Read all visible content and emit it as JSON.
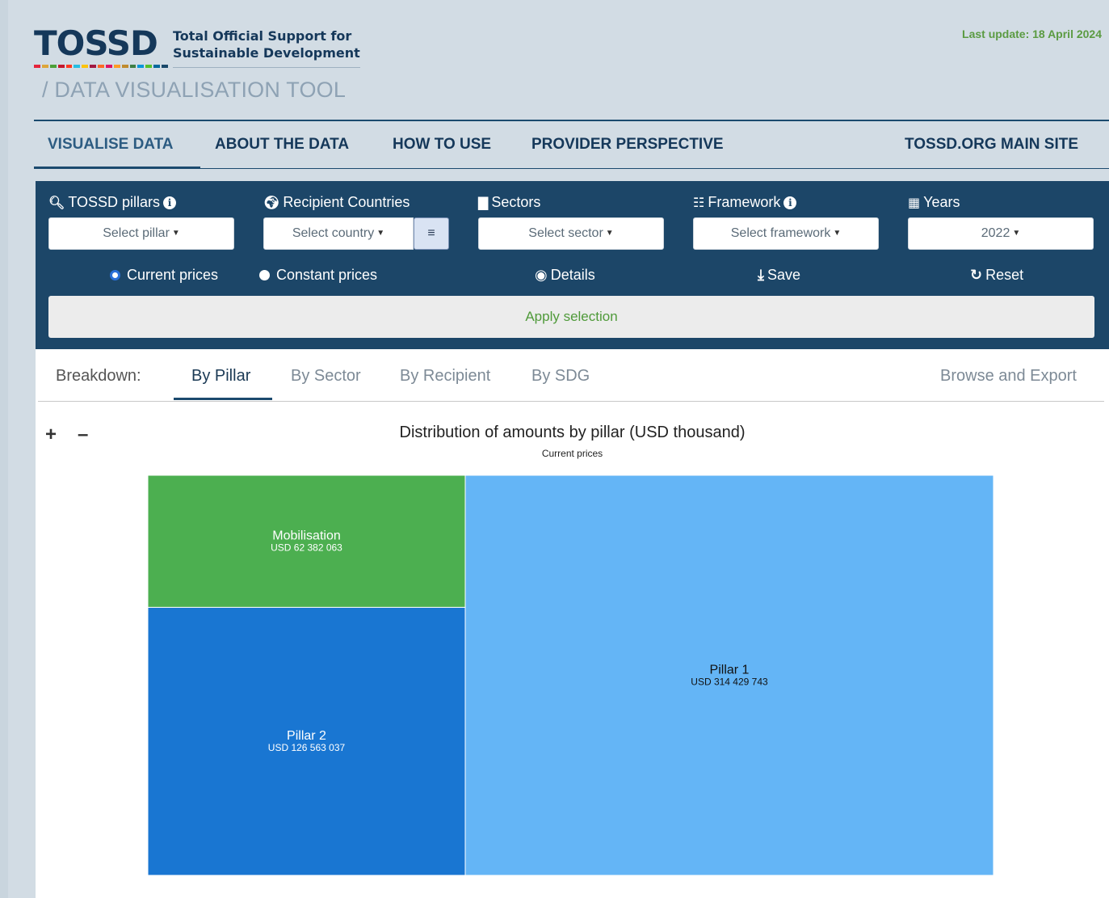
{
  "header": {
    "logo_word": "TOSSD",
    "logo_sub_line1": "Total Official Support for",
    "logo_sub_line2": "Sustainable Development",
    "tool_title": "/ DATA VISUALISATION TOOL",
    "last_update": "Last update: 18 April 2024",
    "sdg_colors": [
      "#e5243b",
      "#dda63a",
      "#4c9f38",
      "#c5192d",
      "#ff3a21",
      "#26bde2",
      "#fcc30b",
      "#a21942",
      "#fd6925",
      "#dd1367",
      "#fd9d24",
      "#bf8b2e",
      "#3f7e44",
      "#0a97d9",
      "#56c02b",
      "#00689d",
      "#19486a"
    ]
  },
  "nav": {
    "visualise": "VISUALISE DATA",
    "about": "ABOUT THE DATA",
    "how_to": "HOW TO USE",
    "provider": "PROVIDER PERSPECTIVE",
    "main_site": "TOSSD.ORG MAIN SITE"
  },
  "filters": {
    "pillars_label": "TOSSD pillars",
    "pillars_select": "Select pillar",
    "countries_label": "Recipient Countries",
    "countries_select": "Select country",
    "sectors_label": "Sectors",
    "sectors_select": "Select sector",
    "framework_label": "Framework",
    "framework_select": "Select framework",
    "years_label": "Years",
    "years_select": "2022",
    "current_prices": "Current prices",
    "constant_prices": "Constant prices",
    "details": "Details",
    "save": "Save",
    "reset": "Reset",
    "apply": "Apply selection",
    "icons": {
      "pillars": "search-icon",
      "countries": "globe-icon",
      "sectors": "bar-chart-icon",
      "framework": "sitemap-icon",
      "years": "calendar-icon",
      "details": "eye-icon",
      "save": "download-icon",
      "reset": "refresh-icon"
    }
  },
  "breakdown": {
    "label": "Breakdown:",
    "tabs": [
      "By Pillar",
      "By Sector",
      "By Recipient",
      "By SDG"
    ],
    "browse": "Browse and Export"
  },
  "chart_data": {
    "type": "treemap",
    "title": "Distribution of amounts by pillar (USD thousand)",
    "subtitle": "Current prices",
    "nodes": [
      {
        "name": "Pillar 1",
        "label": "USD 314 429 743",
        "value": 314429743,
        "color": "#64b5f6"
      },
      {
        "name": "Pillar 2",
        "label": "USD 126 563 037",
        "value": 126563037,
        "color": "#1976d2"
      },
      {
        "name": "Mobilisation",
        "label": "USD 62 382 063",
        "value": 62382063,
        "color": "#4caf50"
      }
    ]
  }
}
